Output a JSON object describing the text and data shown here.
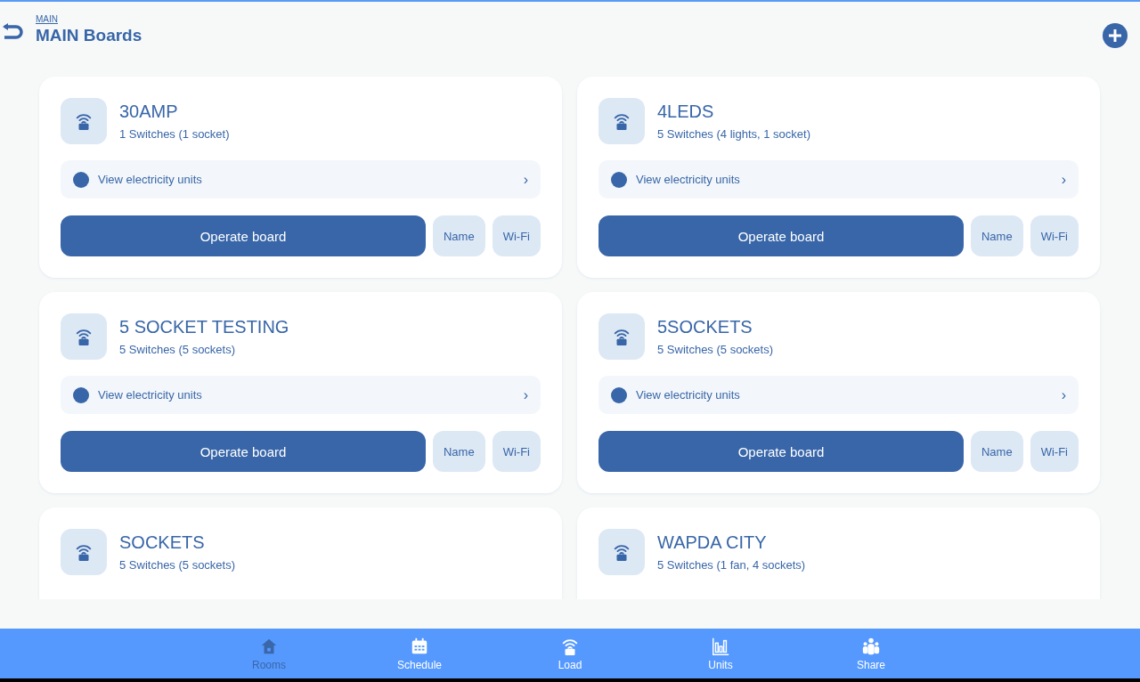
{
  "header": {
    "breadcrumb": "MAIN",
    "title": "MAIN Boards"
  },
  "boards": [
    {
      "name": "30AMP",
      "switches": "1  Switches (1 socket)",
      "units_link": "View electricity units",
      "chevron": "›",
      "operate": "Operate board",
      "name_button": "Name",
      "wifi_button": "Wi-Fi"
    },
    {
      "name": "4LEDS",
      "switches": "5  Switches (4 lights, 1 socket)",
      "units_link": "View electricity units",
      "chevron": "›",
      "operate": "Operate board",
      "name_button": "Name",
      "wifi_button": "Wi-Fi"
    },
    {
      "name": "5 SOCKET TESTING",
      "switches": "5  Switches (5 sockets)",
      "units_link": "View electricity units",
      "chevron": "›",
      "operate": "Operate board",
      "name_button": "Name",
      "wifi_button": "Wi-Fi"
    },
    {
      "name": "5SOCKETS",
      "switches": "5  Switches (5 sockets)",
      "units_link": "View electricity units",
      "chevron": "›",
      "operate": "Operate board",
      "name_button": "Name",
      "wifi_button": "Wi-Fi"
    },
    {
      "name": "SOCKETS",
      "switches": "5  Switches (5 sockets)"
    },
    {
      "name": "WAPDA CITY",
      "switches": "5  Switches (1 fan, 4 sockets)"
    }
  ],
  "nav": [
    {
      "kind": "home",
      "label": "Rooms",
      "selected": true
    },
    {
      "kind": "calendar",
      "label": "Schedule",
      "selected": false
    },
    {
      "kind": "board",
      "label": "Load",
      "selected": false
    },
    {
      "kind": "chart",
      "label": "Units",
      "selected": false
    },
    {
      "kind": "people",
      "label": "Share",
      "selected": false
    }
  ]
}
